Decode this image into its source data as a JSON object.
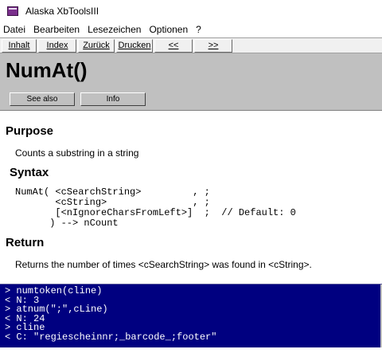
{
  "window": {
    "title": "Alaska XbToolsIII",
    "app_icon": "book-icon"
  },
  "menu": [
    "Datei",
    "Bearbeiten",
    "Lesezeichen",
    "Optionen",
    "?"
  ],
  "toolbar": [
    "Inhalt",
    "Index",
    "Zurück",
    "Drucken",
    "<<",
    ">>"
  ],
  "header": {
    "title": "NumAt()",
    "see_also": "See also",
    "info": "Info"
  },
  "content": {
    "purpose_heading": "Purpose",
    "purpose_text": "Counts a substring in a string",
    "syntax_heading": "Syntax",
    "syntax_lines": [
      "NumAt( <cSearchString>         , ;",
      "       <cString>               , ;",
      "       [<nIgnoreCharsFromLeft>]  ;  // Default: 0",
      "      ) --> nCount"
    ],
    "return_heading": "Return",
    "return_text": "Returns the number of times <cSearchString> was found in <cString>."
  },
  "console": [
    "> numtoken(cline)",
    "< N: 3",
    "> atnum(\";\",cLine)",
    "< N: 24",
    "> cline",
    "< C: \"regiescheinnr;_barcode_;footer\""
  ],
  "colors": {
    "console_bg": "#000080",
    "header_bg": "#c0c0c0",
    "toolbar_bg": "#f0f0f0"
  }
}
